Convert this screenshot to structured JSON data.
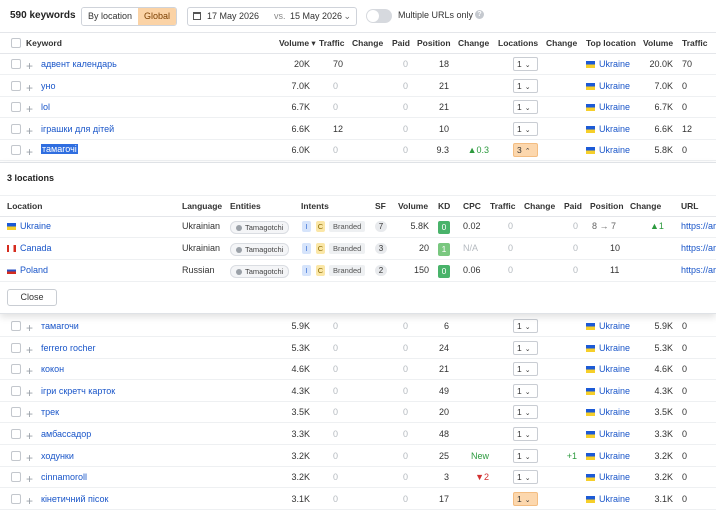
{
  "toolbar": {
    "keyword_count": "590 keywords",
    "scope_options": [
      "By location",
      "Global"
    ],
    "scope_active": "Global",
    "date_from": "17 May 2026",
    "date_vs": "vs.",
    "date_to": "15 May 2026",
    "multiple_urls_label": "Multiple URLs only",
    "multiple_urls_on": false
  },
  "columns": {
    "keyword": "Keyword",
    "volume": "Volume ▾",
    "traffic": "Traffic",
    "change": "Change",
    "paid": "Paid",
    "position": "Position",
    "change2": "Change",
    "locations": "Locations",
    "change3": "Change",
    "top_location": "Top location",
    "volume2": "Volume",
    "traffic2": "Traffic"
  },
  "rows_top": [
    {
      "kw": "адвент календарь",
      "vol": "20K",
      "traffic": "70",
      "change": "",
      "paid": "0",
      "pos": "18",
      "pchange": "",
      "loc": "1",
      "loc_change": "",
      "top": "Ukraine",
      "tvol": "20.0K",
      "ttraffic": "70"
    },
    {
      "kw": "уно",
      "vol": "7.0K",
      "traffic": "0",
      "change": "",
      "paid": "0",
      "pos": "21",
      "pchange": "",
      "loc": "1",
      "loc_change": "",
      "top": "Ukraine",
      "tvol": "7.0K",
      "ttraffic": "0"
    },
    {
      "kw": "lol",
      "vol": "6.7K",
      "traffic": "0",
      "change": "",
      "paid": "0",
      "pos": "21",
      "pchange": "",
      "loc": "1",
      "loc_change": "",
      "top": "Ukraine",
      "tvol": "6.7K",
      "ttraffic": "0"
    },
    {
      "kw": "іграшки для дітей",
      "vol": "6.6K",
      "traffic": "12",
      "change": "",
      "paid": "0",
      "pos": "10",
      "pchange": "",
      "loc": "1",
      "loc_change": "",
      "top": "Ukraine",
      "tvol": "6.6K",
      "ttraffic": "12"
    },
    {
      "kw": "тамагочі",
      "vol": "6.0K",
      "traffic": "0",
      "change": "",
      "paid": "0",
      "pos": "9.3",
      "pchange": "▲0.3",
      "loc": "3",
      "loc_change": "",
      "top": "Ukraine",
      "tvol": "5.8K",
      "ttraffic": "0"
    }
  ],
  "popup": {
    "title": "3 locations",
    "columns": {
      "location": "Location",
      "language": "Language",
      "entities": "Entities",
      "intents": "Intents",
      "sf": "SF",
      "volume": "Volume",
      "kd": "KD",
      "cpc": "CPC",
      "traffic": "Traffic",
      "change": "Change",
      "paid": "Paid",
      "position": "Position",
      "change2": "Change",
      "url": "URL"
    },
    "rows": [
      {
        "loc": "Ukraine",
        "lang": "Ukrainian",
        "entity": "Tamagotchi",
        "i": "I",
        "c": "C",
        "branded": "Branded",
        "sf": "7",
        "vol": "5.8K",
        "kd": "0",
        "cpc": "0.02",
        "traffic": "0",
        "paid": "0",
        "pos": "8 → 7",
        "change": "▲1",
        "url": "https://ar"
      },
      {
        "loc": "Canada",
        "lang": "Ukrainian",
        "entity": "Tamagotchi",
        "i": "I",
        "c": "C",
        "branded": "Branded",
        "sf": "3",
        "vol": "20",
        "kd": "1",
        "cpc": "N/A",
        "traffic": "0",
        "paid": "0",
        "pos": "10",
        "change": "",
        "url": "https://ar"
      },
      {
        "loc": "Poland",
        "lang": "Russian",
        "entity": "Tamagotchi",
        "i": "I",
        "c": "C",
        "branded": "Branded",
        "sf": "2",
        "vol": "150",
        "kd": "0",
        "cpc": "0.06",
        "traffic": "0",
        "paid": "0",
        "pos": "11",
        "change": "",
        "url": "https://ar"
      }
    ],
    "close_label": "Close"
  },
  "rows_bottom": [
    {
      "kw": "тамагочи",
      "vol": "5.9K",
      "traffic": "0",
      "paid": "0",
      "pos": "6",
      "pchange": "",
      "loc": "1",
      "loc_change": "",
      "top": "Ukraine",
      "tvol": "5.9K",
      "ttraffic": "0"
    },
    {
      "kw": "ferrero rocher",
      "vol": "5.3K",
      "traffic": "0",
      "paid": "0",
      "pos": "24",
      "pchange": "",
      "loc": "1",
      "loc_change": "",
      "top": "Ukraine",
      "tvol": "5.3K",
      "ttraffic": "0"
    },
    {
      "kw": "кокон",
      "vol": "4.6K",
      "traffic": "0",
      "paid": "0",
      "pos": "21",
      "pchange": "",
      "loc": "1",
      "loc_change": "",
      "top": "Ukraine",
      "tvol": "4.6K",
      "ttraffic": "0"
    },
    {
      "kw": "ігри скретч карток",
      "vol": "4.3K",
      "traffic": "0",
      "paid": "0",
      "pos": "49",
      "pchange": "",
      "loc": "1",
      "loc_change": "",
      "top": "Ukraine",
      "tvol": "4.3K",
      "ttraffic": "0"
    },
    {
      "kw": "трек",
      "vol": "3.5K",
      "traffic": "0",
      "paid": "0",
      "pos": "20",
      "pchange": "",
      "loc": "1",
      "loc_change": "",
      "top": "Ukraine",
      "tvol": "3.5K",
      "ttraffic": "0"
    },
    {
      "kw": "амбассадор",
      "vol": "3.3K",
      "traffic": "0",
      "paid": "0",
      "pos": "48",
      "pchange": "",
      "loc": "1",
      "loc_change": "",
      "top": "Ukraine",
      "tvol": "3.3K",
      "ttraffic": "0"
    },
    {
      "kw": "ходунки",
      "vol": "3.2K",
      "traffic": "0",
      "paid": "0",
      "pos": "25",
      "pchange": "New",
      "loc": "1",
      "loc_change": "+1",
      "top": "Ukraine",
      "tvol": "3.2K",
      "ttraffic": "0"
    },
    {
      "kw": "cinnamoroll",
      "vol": "3.2K",
      "traffic": "0",
      "paid": "0",
      "pos": "3",
      "pchange": "▼2",
      "loc": "1",
      "loc_change": "",
      "top": "Ukraine",
      "tvol": "3.2K",
      "ttraffic": "0"
    },
    {
      "kw": "кінетичний пісок",
      "vol": "3.1K",
      "traffic": "0",
      "paid": "0",
      "pos": "17",
      "pchange": "",
      "loc": "1",
      "loc_change": "",
      "top": "Ukraine",
      "tvol": "3.1K",
      "ttraffic": "0"
    }
  ],
  "colors": {
    "accent": "#fbd3a6",
    "link": "#1a56c9",
    "positive": "#2c9a3e",
    "negative": "#d23030",
    "kd_easy": "#49b36a"
  }
}
